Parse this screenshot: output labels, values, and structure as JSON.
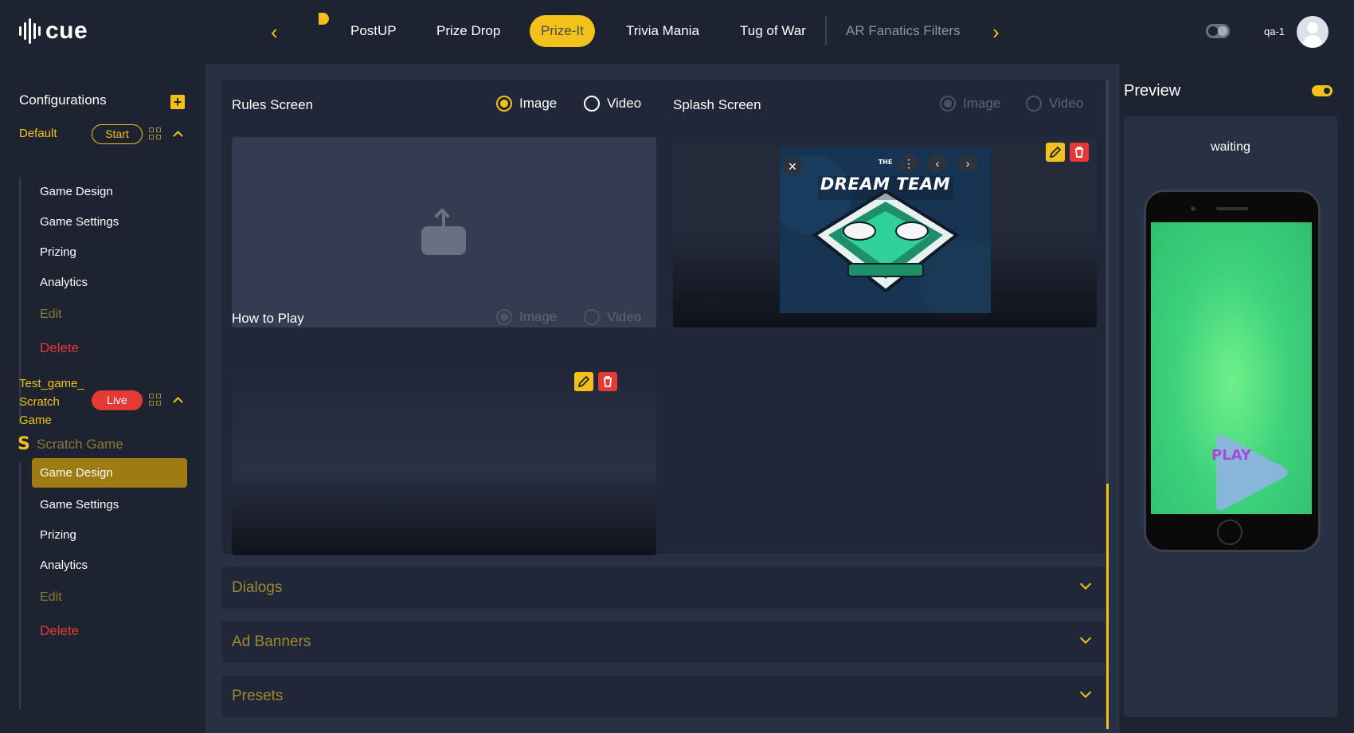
{
  "header": {
    "logo_text": "cue",
    "tabs": [
      {
        "label": "PostUP"
      },
      {
        "label": "Prize Drop"
      },
      {
        "label": "Prize-It"
      },
      {
        "label": "Trivia Mania"
      },
      {
        "label": "Tug of War"
      },
      {
        "label": "AR Fanatics Filters"
      }
    ],
    "active_tab": "Prize-It",
    "user_name": "qa-1",
    "prev_arrow": "‹",
    "next_arrow": "›"
  },
  "sidebar": {
    "title": "Configurations",
    "add_icon": "plus-icon",
    "configs": [
      {
        "name": "Default",
        "status": "Start",
        "items": [
          "Game Design",
          "Game Settings",
          "Prizing",
          "Analytics",
          "Edit",
          "Delete"
        ]
      },
      {
        "name_lines": [
          "Test_game_",
          "Scratch",
          "Game"
        ],
        "status": "Live",
        "game_type": "Scratch Game",
        "items": [
          "Game Design",
          "Game Settings",
          "Prizing",
          "Analytics",
          "Edit",
          "Delete"
        ],
        "active_item": "Game Design"
      }
    ]
  },
  "main": {
    "rules_screen": {
      "label": "Rules Screen",
      "options": [
        "Image",
        "Video"
      ],
      "selected": "Image"
    },
    "splash_screen": {
      "label": "Splash Screen",
      "options": [
        "Image",
        "Video"
      ],
      "selected": "Image",
      "image_text": "DREAM TEAM",
      "image_small_text": "THE"
    },
    "how_to_play": {
      "label": "How to Play",
      "options": [
        "Image",
        "Video"
      ],
      "selected": "Image"
    },
    "accordions": [
      {
        "label": "Dialogs"
      },
      {
        "label": "Ad Banners"
      },
      {
        "label": "Presets"
      }
    ]
  },
  "preview": {
    "title": "Preview",
    "status": "waiting",
    "play_label": "PLAY"
  },
  "colors": {
    "accent": "#f2c21b",
    "danger": "#e53935",
    "background": "#1d2330",
    "panel": "#283043"
  }
}
